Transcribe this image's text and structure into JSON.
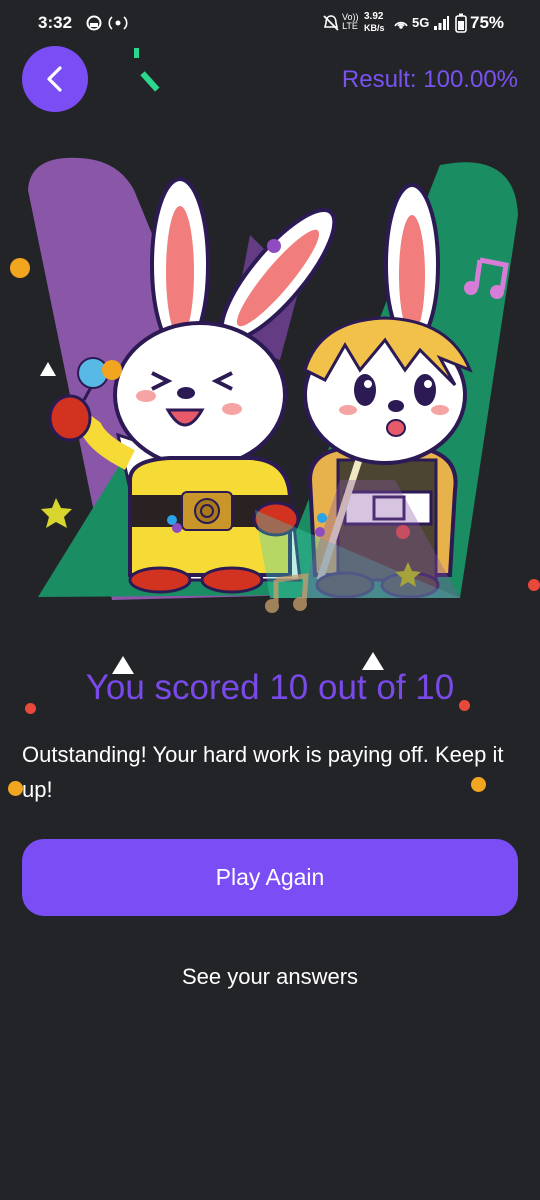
{
  "status_bar": {
    "time": "3:32",
    "speed_value": "3.92",
    "speed_unit": "KB/s",
    "network": "5G",
    "volte": "Vo)) LTE",
    "battery": "75%"
  },
  "header": {
    "result_label": "Result: 100.00%"
  },
  "main": {
    "score_text": "You scored 10 out of 10",
    "message": "Outstanding! Your hard work is paying off. Keep it up!",
    "play_again_label": "Play Again",
    "see_answers_label": "See your answers"
  },
  "colors": {
    "background": "#232428",
    "accent": "#7b4df5",
    "score_text": "#7a4ae9"
  },
  "icons": [
    "back-arrow-icon",
    "mute-icon",
    "hotspot-icon",
    "signal-icon",
    "battery-icon",
    "music-note-icon",
    "star-icon"
  ]
}
